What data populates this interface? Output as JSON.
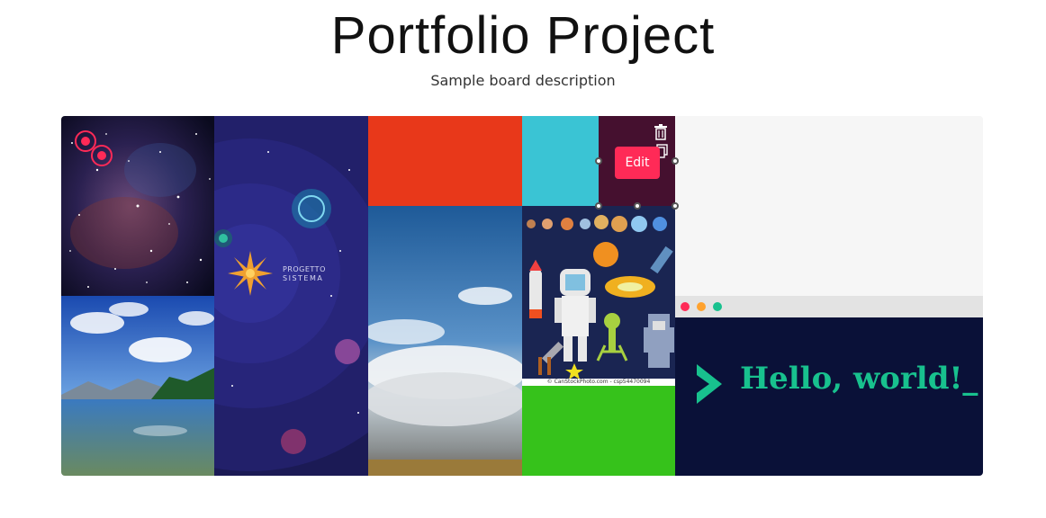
{
  "header": {
    "title": "Portfolio Project",
    "subtitle": "Sample board description"
  },
  "board": {
    "background": "#f6f6f6",
    "tiles": [
      {
        "name": "galaxy-image",
        "kind": "image"
      },
      {
        "name": "lake-landscape-image",
        "kind": "image"
      },
      {
        "name": "progetto-sistema-image",
        "kind": "image",
        "text": "PROGETTO\nSISTEMA"
      },
      {
        "name": "orange-color-block",
        "kind": "color",
        "color": "#e8381a"
      },
      {
        "name": "sky-clouds-image",
        "kind": "image"
      },
      {
        "name": "cyan-color-block",
        "kind": "color",
        "color": "#3ac4d4"
      },
      {
        "name": "plum-color-block",
        "kind": "color",
        "color": "#45102f"
      },
      {
        "name": "pixel-space-art-image",
        "kind": "image"
      },
      {
        "name": "green-color-block",
        "kind": "color",
        "color": "#36c21b"
      },
      {
        "name": "empty-light-block",
        "kind": "color",
        "color": "#f6f6f6"
      },
      {
        "name": "hello-world-card",
        "kind": "image"
      }
    ]
  },
  "progetto": {
    "line1": "PROGETTO",
    "line2": "SISTEMA"
  },
  "pixel_art": {
    "credit": "© CanStockPhoto.com - csp54470094"
  },
  "hello_card": {
    "text": "Hello, world!_",
    "dots": [
      "#ff2a57",
      "#ffa22e",
      "#18c18e"
    ],
    "background": "#0a1138",
    "accent": "#18c18e"
  },
  "toolbar": {
    "edit_label": "Edit",
    "delete_icon": "trash-icon",
    "duplicate_icon": "copy-icon"
  },
  "accent": "#ff2a57"
}
